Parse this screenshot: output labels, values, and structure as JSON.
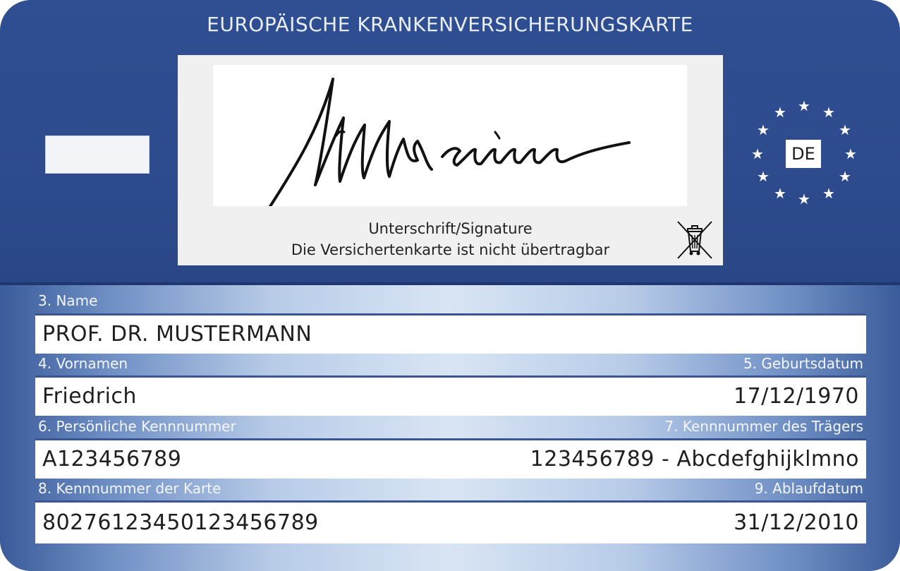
{
  "card": {
    "title": "EUROPÄISCHE KRANKENVERSICHERUNGSKARTE",
    "country_code": "DE",
    "signature_caption": "Unterschrift/Signature",
    "non_transferable_note": "Die Versichertenkarte ist nicht übertragbar",
    "signature_image": "handwritten-signature",
    "waste_symbol_icon": "crossed-out-wheelie-bin-icon",
    "colors": {
      "card_blue": "#2c4a8c",
      "field_gradient_light": "#d9e5f4",
      "field_box": "#ffffff",
      "stars": "#ffffff"
    }
  },
  "fields": {
    "name_label": "3. Name",
    "name_value": "PROF. DR. MUSTERMANN",
    "given_names_label": "4. Vornamen",
    "given_names_value": "Friedrich",
    "birth_date_label": "5. Geburtsdatum",
    "birth_date_value": "17/12/1970",
    "personal_id_label": "6. Persönliche Kennnummer",
    "personal_id_value": "A123456789",
    "institution_id_label": "7. Kennnummer des Trägers",
    "institution_id_value": "123456789 - Abcdefghijklmno",
    "card_id_label": "8. Kennnummer der Karte",
    "card_id_value": "80276123450123456789",
    "expiry_date_label": "9. Ablaufdatum",
    "expiry_date_value": "31/12/2010"
  }
}
